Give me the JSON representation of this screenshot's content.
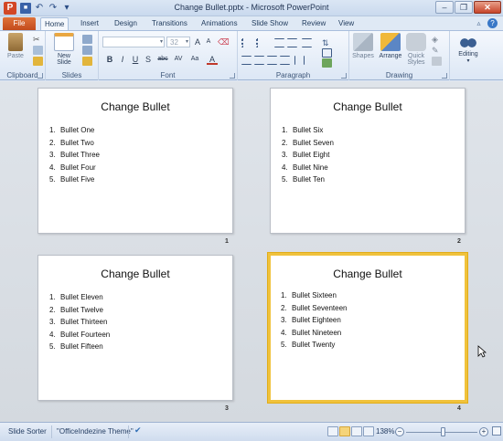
{
  "window": {
    "title": "Change Bullet.pptx - Microsoft PowerPoint",
    "app_letter": "P"
  },
  "qat": {
    "save_icon": "floppy-disk-icon",
    "undo_icon": "undo-icon",
    "redo_icon": "redo-icon",
    "customize_icon": "chevron-down-icon"
  },
  "tabs": [
    {
      "label": "File"
    },
    {
      "label": "Home"
    },
    {
      "label": "Insert"
    },
    {
      "label": "Design"
    },
    {
      "label": "Transitions"
    },
    {
      "label": "Animations"
    },
    {
      "label": "Slide Show"
    },
    {
      "label": "Review"
    },
    {
      "label": "View"
    }
  ],
  "ribbon": {
    "clipboard": {
      "label": "Clipboard",
      "paste": "Paste"
    },
    "slides": {
      "label": "Slides",
      "new_slide_line1": "New",
      "new_slide_line2": "Slide"
    },
    "font": {
      "label": "Font",
      "size": "32"
    },
    "paragraph": {
      "label": "Paragraph"
    },
    "drawing": {
      "label": "Drawing",
      "shapes": "Shapes",
      "arrange": "Arrange",
      "quick_styles_line1": "Quick",
      "quick_styles_line2": "Styles"
    },
    "editing": {
      "label": "Editing"
    }
  },
  "font_buttons": [
    "B",
    "I",
    "U",
    "S",
    "abc",
    "AV",
    "Aa",
    "A"
  ],
  "slides": [
    {
      "number": "1",
      "title": "Change Bullet",
      "items": [
        {
          "n": "1.",
          "text": "Bullet One"
        },
        {
          "n": "2.",
          "text": "Bullet Two"
        },
        {
          "n": "3.",
          "text": "Bullet Three"
        },
        {
          "n": "4.",
          "text": "Bullet Four"
        },
        {
          "n": "5.",
          "text": "Bullet Five"
        }
      ]
    },
    {
      "number": "2",
      "title": "Change Bullet",
      "items": [
        {
          "n": "1.",
          "text": "Bullet Six"
        },
        {
          "n": "2.",
          "text": "Bullet Seven"
        },
        {
          "n": "3.",
          "text": "Bullet Eight"
        },
        {
          "n": "4.",
          "text": "Bullet Nine"
        },
        {
          "n": "5.",
          "text": "Bullet Ten"
        }
      ]
    },
    {
      "number": "3",
      "title": "Change Bullet",
      "items": [
        {
          "n": "1.",
          "text": "Bullet Eleven"
        },
        {
          "n": "2.",
          "text": "Bullet Twelve"
        },
        {
          "n": "3.",
          "text": "Bullet Thirteen"
        },
        {
          "n": "4.",
          "text": "Bullet Fourteen"
        },
        {
          "n": "5.",
          "text": "Bullet Fifteen"
        }
      ]
    },
    {
      "number": "4",
      "title": "Change Bullet",
      "selected": true,
      "items": [
        {
          "n": "1.",
          "text": "Bullet Sixteen"
        },
        {
          "n": "2.",
          "text": "Bullet Seventeen"
        },
        {
          "n": "3.",
          "text": "Bullet Eighteen"
        },
        {
          "n": "4.",
          "text": "Bullet Nineteen"
        },
        {
          "n": "5.",
          "text": "Bullet Twenty"
        }
      ]
    }
  ],
  "status": {
    "view": "Slide Sorter",
    "theme": "\"OfficeIndezine Theme\"",
    "zoom": "138%",
    "zoom_minus": "−",
    "zoom_plus": "+"
  }
}
